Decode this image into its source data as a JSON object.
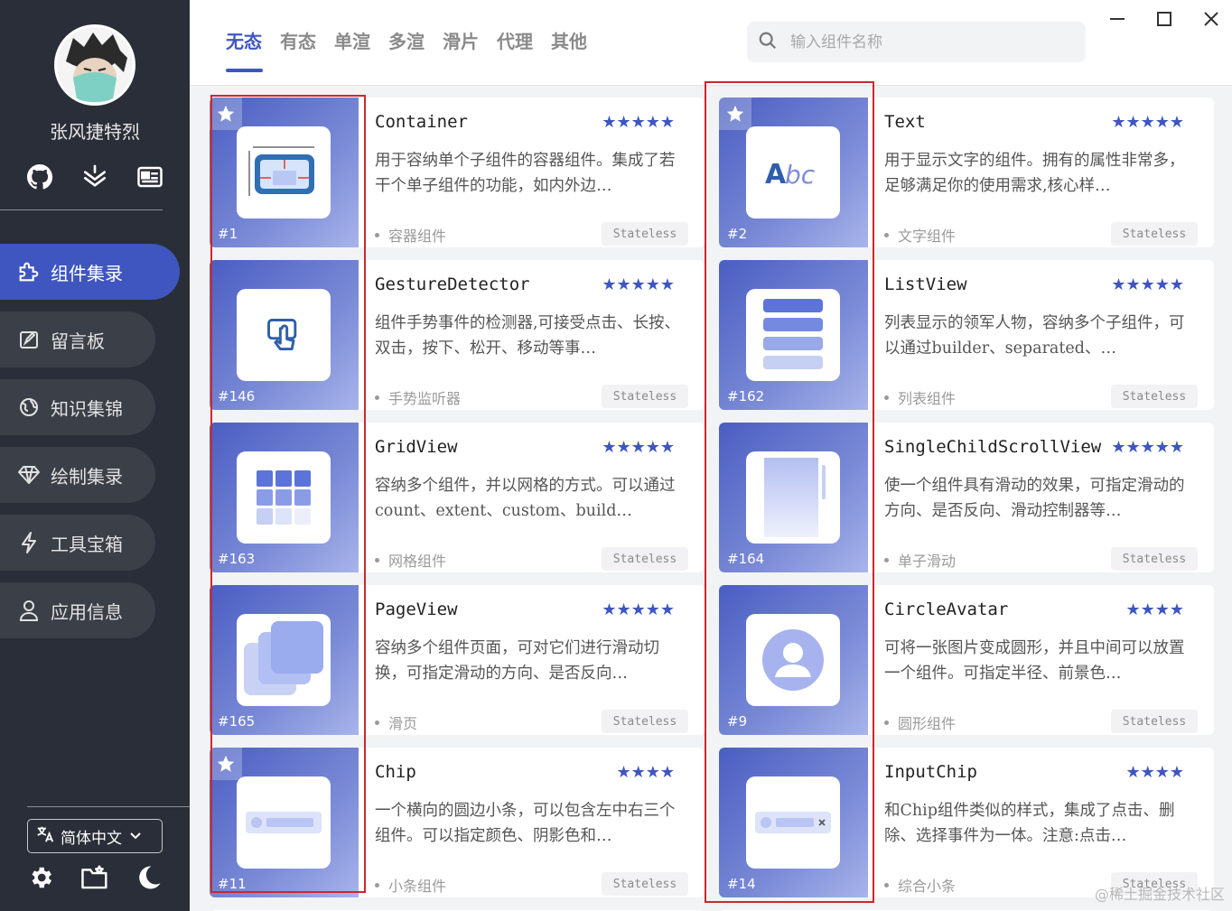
{
  "sidebar": {
    "user_name": "张风捷特烈",
    "nav": [
      {
        "label": "组件集录",
        "icon": "puzzle-icon",
        "active": true
      },
      {
        "label": "留言板",
        "icon": "edit-board-icon",
        "active": false
      },
      {
        "label": "知识集锦",
        "icon": "globe-icon",
        "active": false
      },
      {
        "label": "绘制集录",
        "icon": "diamond-icon",
        "active": false
      },
      {
        "label": "工具宝箱",
        "icon": "lightning-icon",
        "active": false
      },
      {
        "label": "应用信息",
        "icon": "person-icon",
        "active": false
      }
    ],
    "language": "简体中文"
  },
  "topbar": {
    "tabs": [
      "无态",
      "有态",
      "单渲",
      "多渲",
      "滑片",
      "代理",
      "其他"
    ],
    "active_tab": "无态",
    "search_placeholder": "输入组件名称"
  },
  "colors": {
    "accent": "#3f56c0",
    "sidebar_bg": "#2a2e38",
    "highlight_box": "#d0262c"
  },
  "cards": [
    {
      "id": "#1",
      "title": "Container",
      "stars": "★★★★★",
      "desc": "用于容纳单个子组件的容器组件。集成了若干个单子组件的功能，如内外边…",
      "tag": "容器组件",
      "type": "Stateless",
      "starred": true,
      "icon": "container-icon"
    },
    {
      "id": "#2",
      "title": "Text",
      "stars": "★★★★★",
      "desc": "用于显示文字的组件。拥有的属性非常多，足够满足你的使用需求,核心样…",
      "tag": "文字组件",
      "type": "Stateless",
      "starred": true,
      "icon": "text-abc-icon"
    },
    {
      "id": "#146",
      "title": "GestureDetector",
      "stars": "★★★★★",
      "desc": "组件手势事件的检测器,可接受点击、长按、双击，按下、松开、移动等事…",
      "tag": "手势监听器",
      "type": "Stateless",
      "starred": false,
      "icon": "gesture-icon"
    },
    {
      "id": "#162",
      "title": "ListView",
      "stars": "★★★★★",
      "desc": "列表显示的领军人物，容纳多个子组件，可以通过builder、separated、…",
      "tag": "列表组件",
      "type": "Stateless",
      "starred": false,
      "icon": "list-icon"
    },
    {
      "id": "#163",
      "title": "GridView",
      "stars": "★★★★★",
      "desc": "容纳多个组件，并以网格的方式。可以通过count、extent、custom、build…",
      "tag": "网格组件",
      "type": "Stateless",
      "starred": false,
      "icon": "grid-icon"
    },
    {
      "id": "#164",
      "title": "SingleChildScrollView",
      "stars": "★★★★★",
      "desc": "使一个组件具有滑动的效果，可指定滑动的方向、是否反向、滑动控制器等…",
      "tag": "单子滑动",
      "type": "Stateless",
      "starred": false,
      "icon": "scroll-icon"
    },
    {
      "id": "#165",
      "title": "PageView",
      "stars": "★★★★★",
      "desc": "容纳多个组件页面，可对它们进行滑动切换，可指定滑动的方向、是否反向…",
      "tag": "滑页",
      "type": "Stateless",
      "starred": false,
      "icon": "pages-icon"
    },
    {
      "id": "#9",
      "title": "CircleAvatar",
      "stars": "★★★★",
      "desc": "可将一张图片变成圆形，并且中间可以放置一个组件。可指定半径、前景色…",
      "tag": "圆形组件",
      "type": "Stateless",
      "starred": false,
      "icon": "avatar-icon"
    },
    {
      "id": "#11",
      "title": "Chip",
      "stars": "★★★★",
      "desc": "一个横向的圆边小条，可以包含左中右三个组件。可以指定颜色、阴影色和…",
      "tag": "小条组件",
      "type": "Stateless",
      "starred": true,
      "icon": "chip-icon"
    },
    {
      "id": "#14",
      "title": "InputChip",
      "stars": "★★★★",
      "desc": "和Chip组件类似的样式，集成了点击、删除、选择事件为一体。注意:点击…",
      "tag": "综合小条",
      "type": "Stateless",
      "starred": false,
      "icon": "input-chip-icon"
    }
  ],
  "watermark": "@稀土掘金技术社区"
}
